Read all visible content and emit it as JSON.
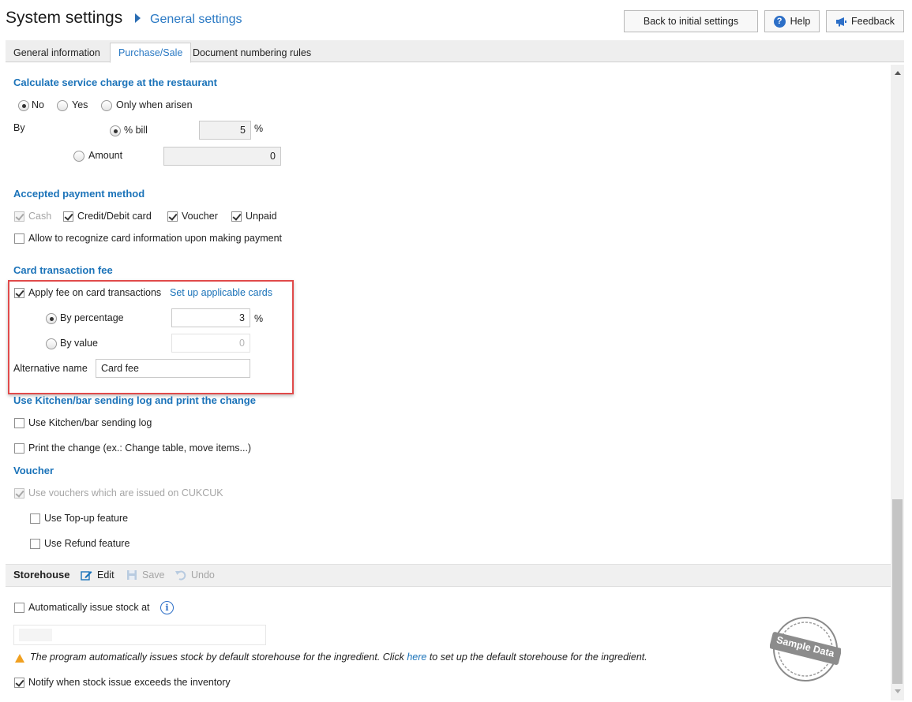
{
  "header": {
    "title": "System settings",
    "breadcrumb_sub": "General settings",
    "back_button": "Back to initial settings",
    "help_button": "Help",
    "feedback_button": "Feedback"
  },
  "tabs": [
    {
      "label": "General information"
    },
    {
      "label": "Purchase/Sale",
      "active": true
    },
    {
      "label": "Document numbering rules"
    }
  ],
  "service_charge": {
    "title": "Calculate service charge at the restaurant",
    "options": [
      "No",
      "Yes",
      "Only when arisen"
    ],
    "selected": "No",
    "by_label": "By",
    "percent_bill_label": "% bill",
    "percent_value": "5",
    "percent_unit": "%",
    "amount_label": "Amount",
    "amount_value": "0"
  },
  "payment": {
    "title": "Accepted payment method",
    "methods": [
      {
        "label": "Cash",
        "checked": true,
        "disabled": true
      },
      {
        "label": "Credit/Debit card",
        "checked": true
      },
      {
        "label": "Voucher",
        "checked": true
      },
      {
        "label": "Unpaid",
        "checked": true
      }
    ],
    "allow_card_info": "Allow to recognize card information upon making payment"
  },
  "card_fee": {
    "title": "Card transaction fee",
    "apply_label": "Apply fee on card transactions",
    "setup_link": "Set up applicable cards",
    "by_percentage": "By percentage",
    "percentage_value": "3",
    "percentage_unit": "%",
    "by_value": "By value",
    "value_value": "0",
    "alt_name_label": "Alternative name",
    "alt_name_value": "Card fee"
  },
  "kitchen": {
    "title": "Use Kitchen/bar sending log and print the change",
    "use_log": "Use Kitchen/bar sending log",
    "print_change": "Print the change (ex.: Change table, move items...)"
  },
  "voucher": {
    "title": "Voucher",
    "use_cukcuk": "Use vouchers which are issued on CUKCUK",
    "topup": "Use Top-up feature",
    "refund": "Use Refund feature"
  },
  "storehouse": {
    "title": "Storehouse",
    "edit": "Edit",
    "save": "Save",
    "undo": "Undo",
    "auto_issue": "Automatically issue stock at",
    "warning_prefix": "The program automatically issues stock by default storehouse for the ingredient. Click ",
    "warning_link": "here",
    "warning_suffix": " to set up the default storehouse for the ingredient.",
    "notify": "Notify when stock issue exceeds the inventory"
  },
  "stamp": "Sample Data"
}
